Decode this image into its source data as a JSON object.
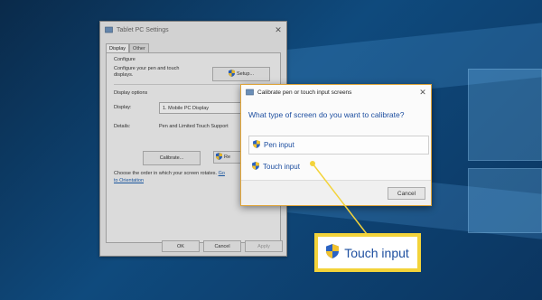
{
  "tablet_settings": {
    "title": "Tablet PC Settings",
    "tabs": [
      {
        "label": "Display"
      },
      {
        "label": "Other"
      }
    ],
    "configure": {
      "heading": "Configure",
      "description_line1": "Configure your pen and touch",
      "description_line2": "displays.",
      "setup_label": "Setup..."
    },
    "display_options": {
      "heading": "Display options",
      "display_label": "Display:",
      "display_value": "1. Mobile PC Display",
      "details_label": "Details:",
      "details_value": "Pen and Limited Touch Support",
      "calibrate_label": "Calibrate...",
      "reset_label": "Re"
    },
    "orientation": {
      "text": "Choose the order in which your screen rotates.",
      "link_part1": "Go",
      "link_part2": "to Orientation"
    },
    "footer": {
      "ok": "OK",
      "cancel": "Cancel",
      "apply": "Apply"
    }
  },
  "calibrate_dialog": {
    "title": "Calibrate pen or touch input screens",
    "question": "What type of screen do you want to calibrate?",
    "options": [
      {
        "label": "Pen input"
      },
      {
        "label": "Touch input"
      }
    ],
    "cancel": "Cancel"
  },
  "callout": {
    "label": "Touch input"
  },
  "colors": {
    "accent": "#1e4fa0",
    "highlight": "#f3d33a",
    "dialog_border": "#e0a53a"
  }
}
